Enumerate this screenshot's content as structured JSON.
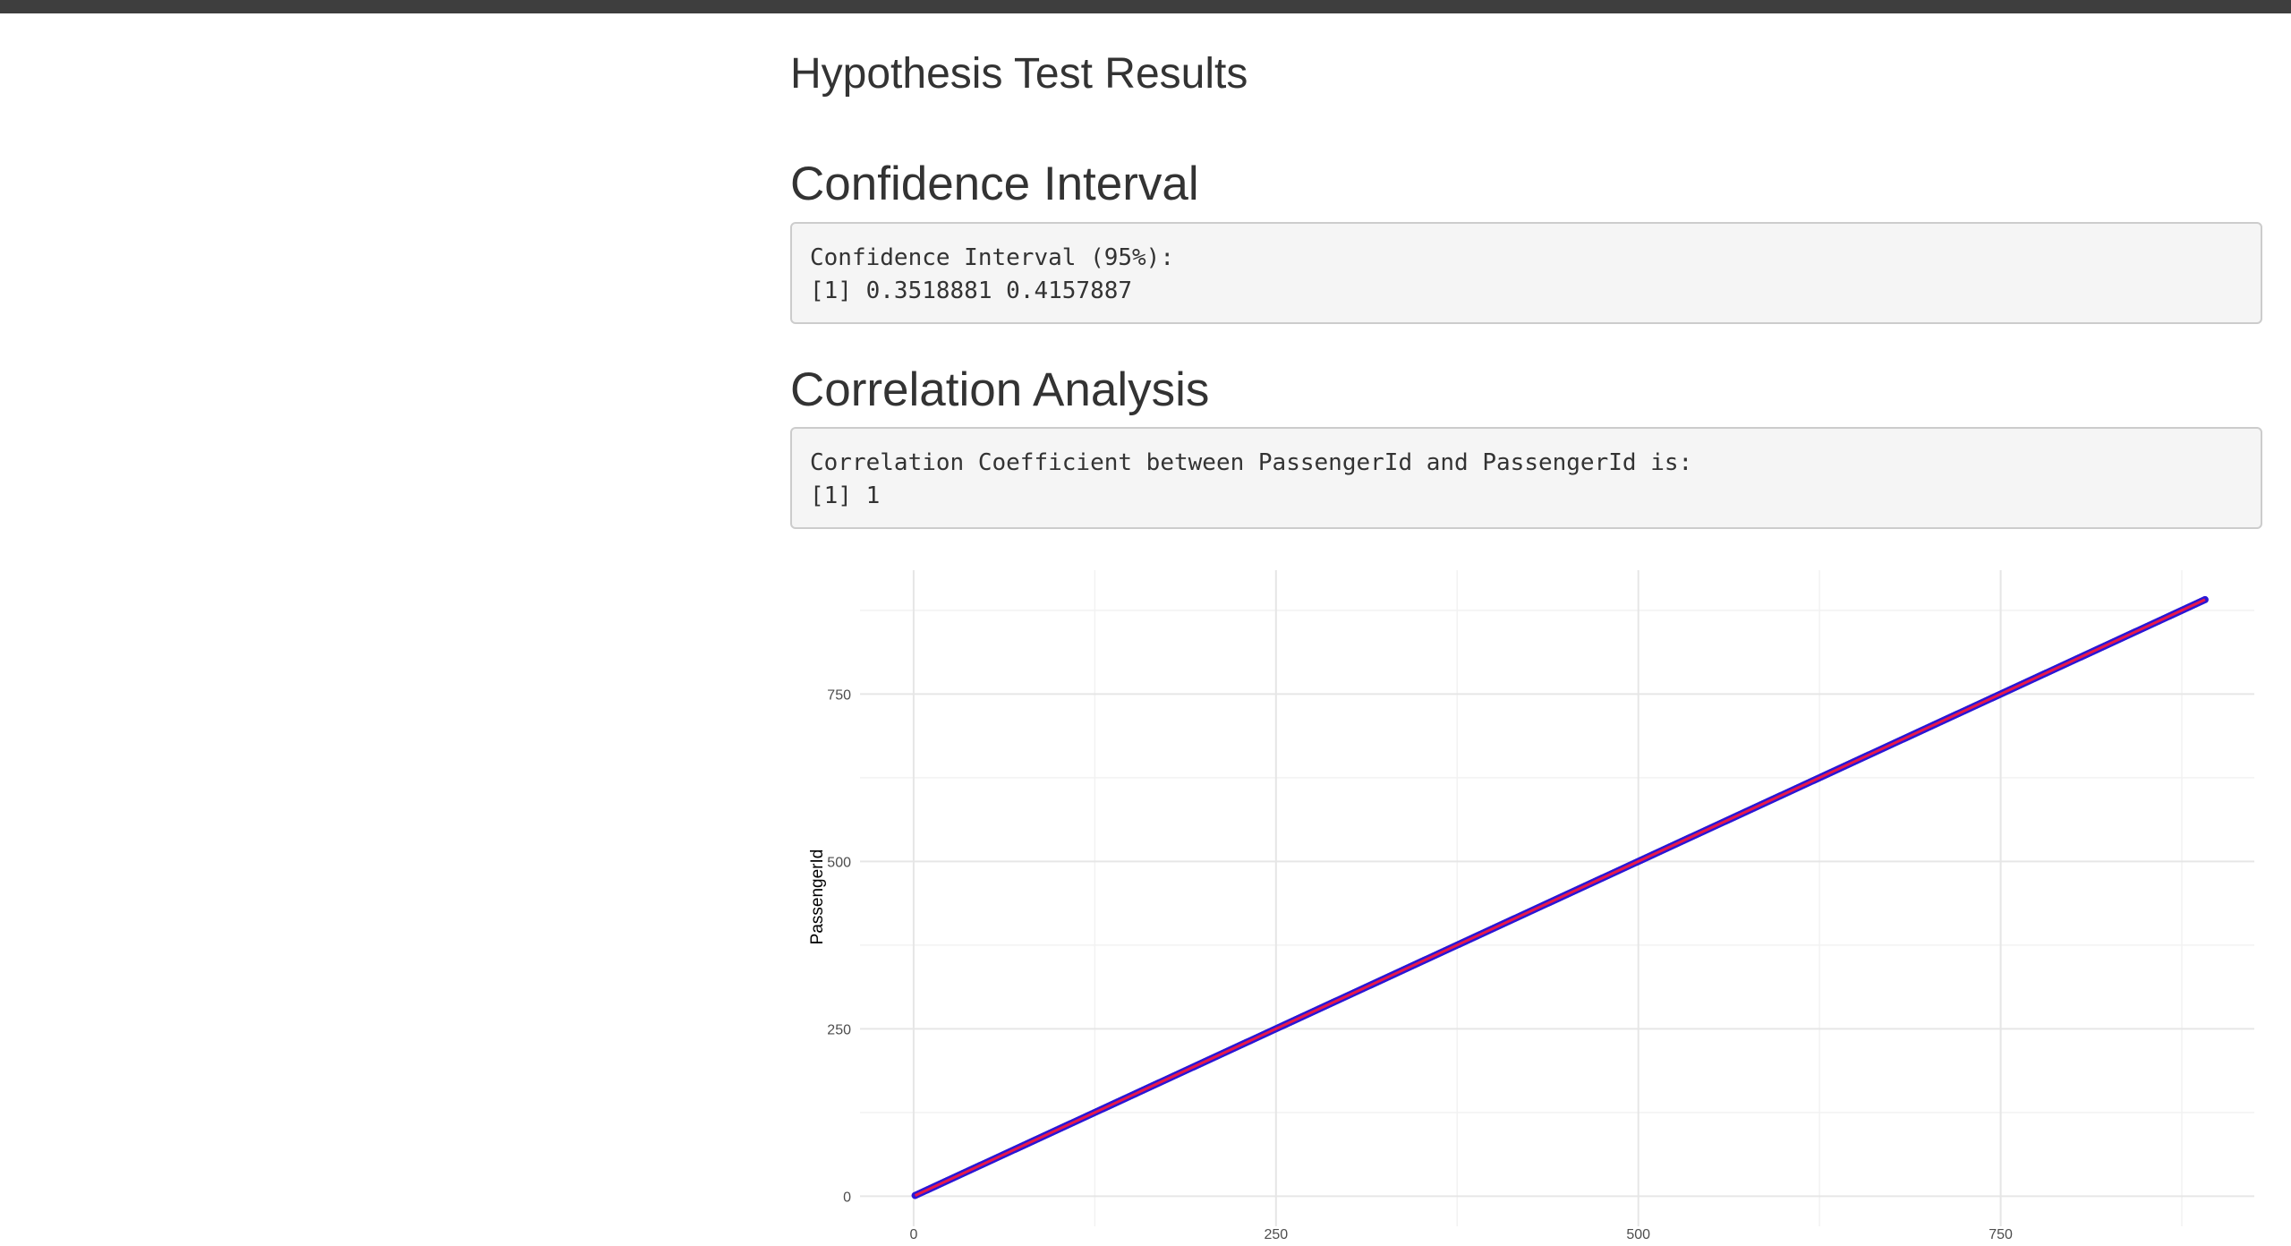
{
  "page": {
    "title": "Hypothesis Test Results"
  },
  "confidence": {
    "heading": "Confidence Interval",
    "output_lines": [
      "Confidence Interval (95%):",
      "[1] 0.3518881 0.4157887"
    ]
  },
  "correlation": {
    "heading": "Correlation Analysis",
    "output_lines": [
      "Correlation Coefficient between PassengerId and PassengerId is:",
      "[1] 1"
    ]
  },
  "colors": {
    "top_bar": "#3e3e3e",
    "point_color": "#2a17d6",
    "line_color": "#e8194a",
    "grid_major": "#e6e6e6",
    "grid_minor": "#f2f2f2"
  },
  "chart_data": {
    "type": "scatter",
    "title": "",
    "xlabel": "",
    "ylabel": "PassengerId",
    "x_ticks": [
      0,
      250,
      500,
      750
    ],
    "y_ticks": [
      0,
      250,
      500,
      750
    ],
    "xlim": [
      -37,
      925
    ],
    "ylim": [
      -45,
      935
    ],
    "grid": true,
    "series": [
      {
        "points_x_range": [
          1,
          891
        ],
        "points_y_range": [
          1,
          891
        ],
        "relationship": "y = x"
      }
    ],
    "regression_line": {
      "slope": 1,
      "intercept": 0,
      "x_range": [
        1,
        891
      ]
    }
  }
}
